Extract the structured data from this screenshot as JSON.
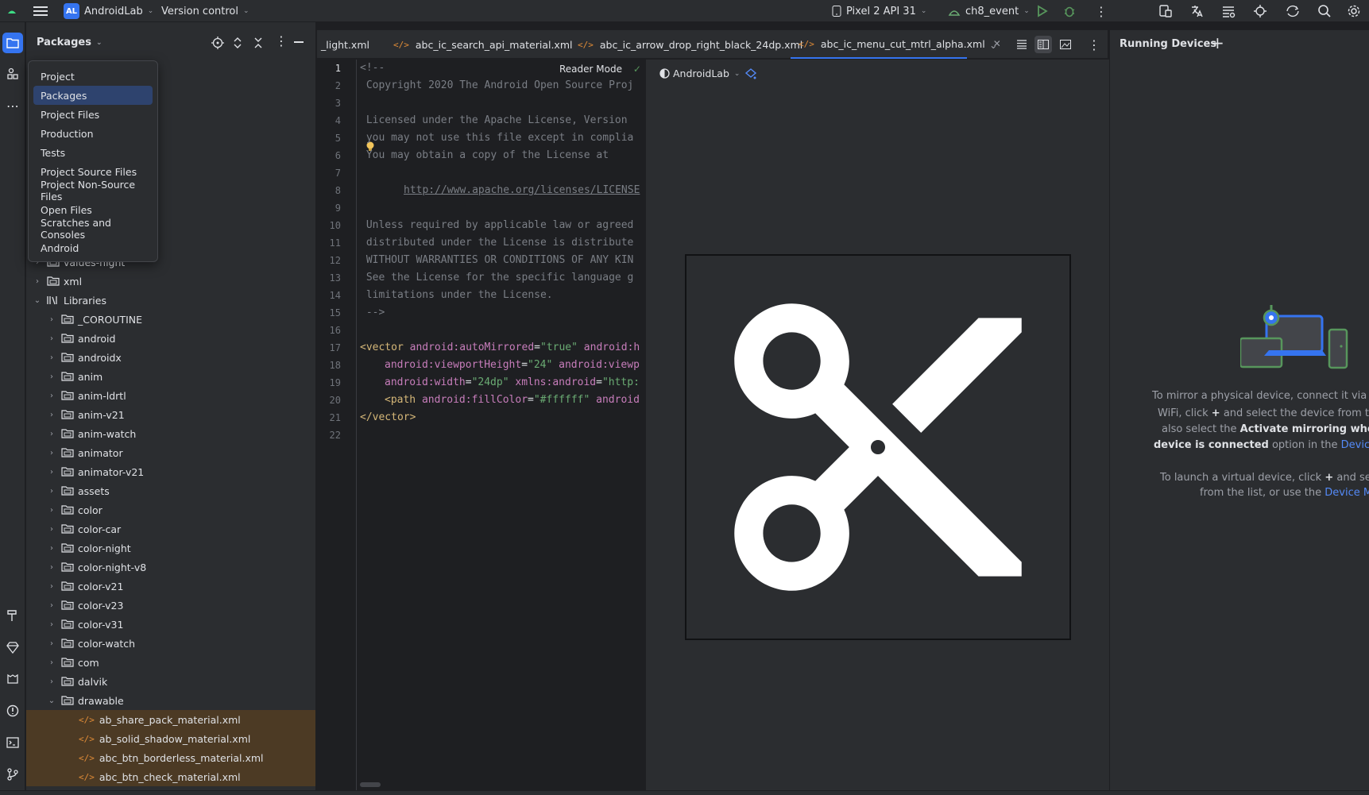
{
  "topbar": {
    "project_badge": "AL",
    "project_name": "AndroidLab",
    "vcs": "Version control",
    "device": "Pixel 2 API 31",
    "run_config": "ch8_event"
  },
  "project_panel": {
    "view_selector": "Packages",
    "view_options": [
      "Project",
      "Packages",
      "Project Files",
      "Production",
      "Tests",
      "Project Source Files",
      "Project Non-Source Files",
      "Open Files",
      "Scratches and Consoles",
      "Android"
    ],
    "selected_option": "Packages",
    "tree": [
      {
        "label": "values-night",
        "level": 1,
        "expanded": false,
        "type": "folder"
      },
      {
        "label": "xml",
        "level": 1,
        "expanded": false,
        "type": "folder"
      },
      {
        "label": "Libraries",
        "level": 1,
        "expanded": true,
        "type": "library"
      },
      {
        "label": "_COROUTINE",
        "level": 2,
        "expanded": false,
        "type": "folder"
      },
      {
        "label": "android",
        "level": 2,
        "expanded": false,
        "type": "folder"
      },
      {
        "label": "androidx",
        "level": 2,
        "expanded": false,
        "type": "folder"
      },
      {
        "label": "anim",
        "level": 2,
        "expanded": false,
        "type": "folder"
      },
      {
        "label": "anim-ldrtl",
        "level": 2,
        "expanded": false,
        "type": "folder"
      },
      {
        "label": "anim-v21",
        "level": 2,
        "expanded": false,
        "type": "folder"
      },
      {
        "label": "anim-watch",
        "level": 2,
        "expanded": false,
        "type": "folder"
      },
      {
        "label": "animator",
        "level": 2,
        "expanded": false,
        "type": "folder"
      },
      {
        "label": "animator-v21",
        "level": 2,
        "expanded": false,
        "type": "folder"
      },
      {
        "label": "assets",
        "level": 2,
        "expanded": false,
        "type": "folder"
      },
      {
        "label": "color",
        "level": 2,
        "expanded": false,
        "type": "folder"
      },
      {
        "label": "color-car",
        "level": 2,
        "expanded": false,
        "type": "folder"
      },
      {
        "label": "color-night",
        "level": 2,
        "expanded": false,
        "type": "folder"
      },
      {
        "label": "color-night-v8",
        "level": 2,
        "expanded": false,
        "type": "folder"
      },
      {
        "label": "color-v21",
        "level": 2,
        "expanded": false,
        "type": "folder"
      },
      {
        "label": "color-v23",
        "level": 2,
        "expanded": false,
        "type": "folder"
      },
      {
        "label": "color-v31",
        "level": 2,
        "expanded": false,
        "type": "folder"
      },
      {
        "label": "color-watch",
        "level": 2,
        "expanded": false,
        "type": "folder"
      },
      {
        "label": "com",
        "level": 2,
        "expanded": false,
        "type": "folder"
      },
      {
        "label": "dalvik",
        "level": 2,
        "expanded": false,
        "type": "folder"
      },
      {
        "label": "drawable",
        "level": 2,
        "expanded": true,
        "type": "folder"
      },
      {
        "label": "ab_share_pack_material.xml",
        "level": 3,
        "type": "xml"
      },
      {
        "label": "ab_solid_shadow_material.xml",
        "level": 3,
        "type": "xml"
      },
      {
        "label": "abc_btn_borderless_material.xml",
        "level": 3,
        "type": "xml"
      },
      {
        "label": "abc_btn_check_material.xml",
        "level": 3,
        "type": "xml"
      }
    ]
  },
  "tabs": [
    {
      "label": "_light.xml",
      "active": false
    },
    {
      "label": "abc_ic_search_api_material.xml",
      "active": false
    },
    {
      "label": "abc_ic_arrow_drop_right_black_24dp.xml",
      "active": false
    },
    {
      "label": "abc_ic_menu_cut_mtrl_alpha.xml",
      "active": true
    }
  ],
  "editor": {
    "reader_mode": "Reader Mode",
    "line_numbers": [
      "1",
      "2",
      "3",
      "4",
      "5",
      "6",
      "7",
      "8",
      "9",
      "10",
      "11",
      "12",
      "13",
      "14",
      "15",
      "16",
      "17",
      "18",
      "19",
      "20",
      "21",
      "22"
    ],
    "current_line": 1,
    "lines": {
      "l1": "<!--",
      "l2": " Copyright 2020 The Android Open Source Proj",
      "l4": " Licensed under the Apache License, Version",
      "l5": " you may not use this file except in complia",
      "l6": " You may obtain a copy of the License at",
      "l8_link": "http://www.apache.org/licenses/LICENSE",
      "l10": " Unless required by applicable law or agreed",
      "l11": " distributed under the License is distribute",
      "l12": " WITHOUT WARRANTIES OR CONDITIONS OF ANY KIN",
      "l13": " See the License for the specific language g",
      "l14": " limitations under the License.",
      "l15": " -->",
      "l17": {
        "tag": "<vector",
        "a1": "android:autoMirrored",
        "v1": "\"true\"",
        "a2": "android:h"
      },
      "l18": {
        "a1": "android:viewportHeight",
        "v1": "\"24\"",
        "a2": "android:viewp"
      },
      "l19": {
        "a1": "android:width",
        "v1": "\"24dp\"",
        "a2": "xmlns:android",
        "v2": "\"http:"
      },
      "l20": {
        "tag": "<path",
        "a1": "android:fillColor",
        "v1": "\"#ffffff\"",
        "a2": "android"
      },
      "l21": "</vector>"
    }
  },
  "preview": {
    "theme": "AndroidLab"
  },
  "running_devices": {
    "title": "Running Devices",
    "p1_line1": "To mirror a physical device, connect it via USB",
    "p1_line2a": "WiFi, click",
    "p1_line2b": "and select the device from the",
    "p1_line3a": "also select the",
    "p1_line3b": "Activate mirroring when a",
    "p1_line4a": "device is connected",
    "p1_line4b": "option in the",
    "p1_line4c": "Device Mirroring",
    "p2_line1a": "To launch a virtual device, click",
    "p2_line1b": "and select",
    "p2_line2a": "from the list, or use the",
    "p2_line2b": "Device Manager"
  },
  "colors": {
    "accent": "#3574f0",
    "background": "#1e1f22",
    "panel": "#2b2d30",
    "xml_icon": "#e08c37"
  }
}
